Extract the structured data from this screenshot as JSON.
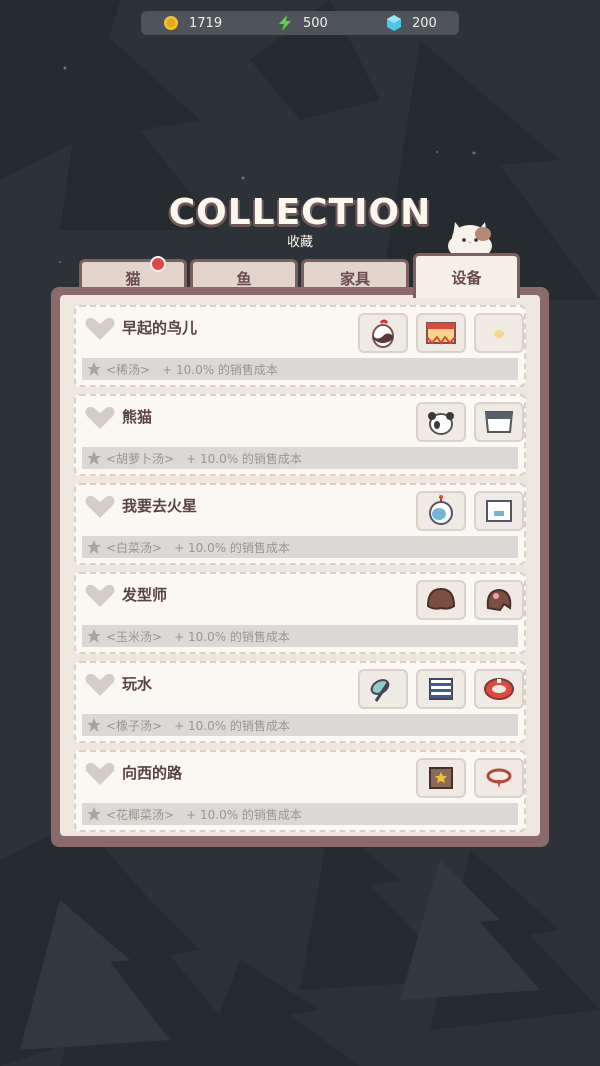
{
  "resources": {
    "coins": "1719",
    "energy": "500",
    "gems": "200",
    "icons": [
      "coin-icon",
      "lightning-icon",
      "gem-icon"
    ]
  },
  "header": {
    "title": "COLLECTION",
    "subtitle": "收藏"
  },
  "tabs": [
    {
      "label": "猫",
      "has_badge": true
    },
    {
      "label": "鱼"
    },
    {
      "label": "家具"
    },
    {
      "label": "设备",
      "active": true
    }
  ],
  "collections": [
    {
      "name": "早起的鸟儿",
      "soup": "<稀汤>",
      "bonus": "+ 10.0% 的销售成本",
      "items": [
        "egg-item-icon",
        "tablecloth-item-icon",
        "nest-item-icon"
      ]
    },
    {
      "name": "熊猫",
      "soup": "<胡萝卜汤>",
      "bonus": "+ 10.0% 的销售成本",
      "items": [
        "panda-costume-icon",
        "panda-outfit-icon"
      ]
    },
    {
      "name": "我要去火星",
      "soup": "<白菜汤>",
      "bonus": "+ 10.0% 的销售成本",
      "items": [
        "space-helmet-icon",
        "space-suit-icon"
      ]
    },
    {
      "name": "发型师",
      "soup": "<玉米汤>",
      "bonus": "+ 10.0% 的销售成本",
      "items": [
        "brown-wig-icon",
        "flower-wig-icon"
      ]
    },
    {
      "name": "玩水",
      "soup": "<橡子汤>",
      "bonus": "+ 10.0% 的销售成本",
      "items": [
        "snorkel-icon",
        "striped-shirt-icon",
        "swim-ring-icon"
      ]
    },
    {
      "name": "向西的路",
      "soup": "<花椰菜汤>",
      "bonus": "+ 10.0% 的销售成本",
      "items": [
        "sheriff-vest-icon",
        "bandana-icon"
      ]
    }
  ],
  "colors": {
    "panel_border": "#8a6a6a",
    "tab_text": "#6b4b4b",
    "badge": "#e04848"
  }
}
